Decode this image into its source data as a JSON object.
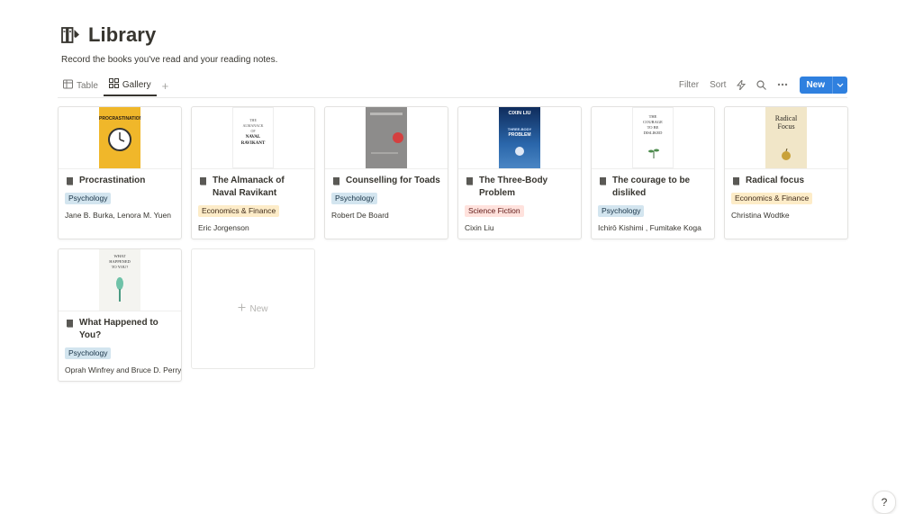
{
  "page": {
    "title": "Library",
    "description": "Record the books you've read and your reading notes."
  },
  "views": {
    "table_label": "Table",
    "gallery_label": "Gallery",
    "add_view": "+"
  },
  "toolbar": {
    "filter": "Filter",
    "sort": "Sort",
    "new_label": "New"
  },
  "cards": [
    {
      "title": "Procrastination",
      "tag": "Psychology",
      "authors": "Jane B. Burka, Lenora M. Yuen",
      "cover": {
        "title": "PROCRASTINATION",
        "bg": "#f0b72a",
        "fg": "#2b2016"
      }
    },
    {
      "title": "The Almanack of Naval Ravikant",
      "tag": "Economics & Finance",
      "authors": "Eric Jorgenson",
      "cover": {
        "line1": "THE",
        "line2": "ALMANACK",
        "line3": "OF",
        "line4": "NAVAL",
        "line5": "RAVIKANT",
        "bg": "#ffffff",
        "fg": "#222222"
      }
    },
    {
      "title": "Counselling for Toads",
      "tag": "Psychology",
      "authors": "Robert De Board",
      "cover": {
        "bg": "#8d8c8b",
        "accent": "#d44040"
      }
    },
    {
      "title": "The Three-Body Problem",
      "tag": "Science Fiction",
      "authors": "Cixin Liu",
      "cover": {
        "author": "CIXIN LIU",
        "title_top": "THREE-BODY",
        "title_bottom": "PROBLEM",
        "bg": "#1f4f8a",
        "fg": "#ffffff"
      }
    },
    {
      "title": "The courage to be disliked",
      "tag": "Psychology",
      "authors": "Ichirō Kishimi , Fumitake Koga",
      "cover": {
        "line1": "THE",
        "line2": "COURAGE",
        "line3": "TO BE",
        "line4": "DISLIKED",
        "bg": "#ffffff",
        "fg": "#333333"
      }
    },
    {
      "title": "Radical focus",
      "tag": "Economics & Finance",
      "authors": "Christina Wodtke",
      "cover": {
        "line1": "Radical",
        "line2": "Focus",
        "bg": "#f1e6c8",
        "fg": "#2d2a24"
      }
    },
    {
      "title": "What Happened to You?",
      "tag": "Psychology",
      "authors": "Oprah Winfrey and Bruce D. Perry",
      "cover": {
        "line1": "WHAT",
        "line2": "HAPPENED",
        "line3": "TO YOU?",
        "bg": "#f4f4f0",
        "fg": "#333333"
      }
    }
  ],
  "new_card_label": "New",
  "help": "?",
  "tag_colors": {
    "Psychology": {
      "bg": "#d3e5ef",
      "fg": "#183347"
    },
    "Economics & Finance": {
      "bg": "#fdecc8",
      "fg": "#402c1b"
    },
    "Science Fiction": {
      "bg": "#ffe2dd",
      "fg": "#5d1715"
    }
  },
  "accent_color": "#2f80df"
}
